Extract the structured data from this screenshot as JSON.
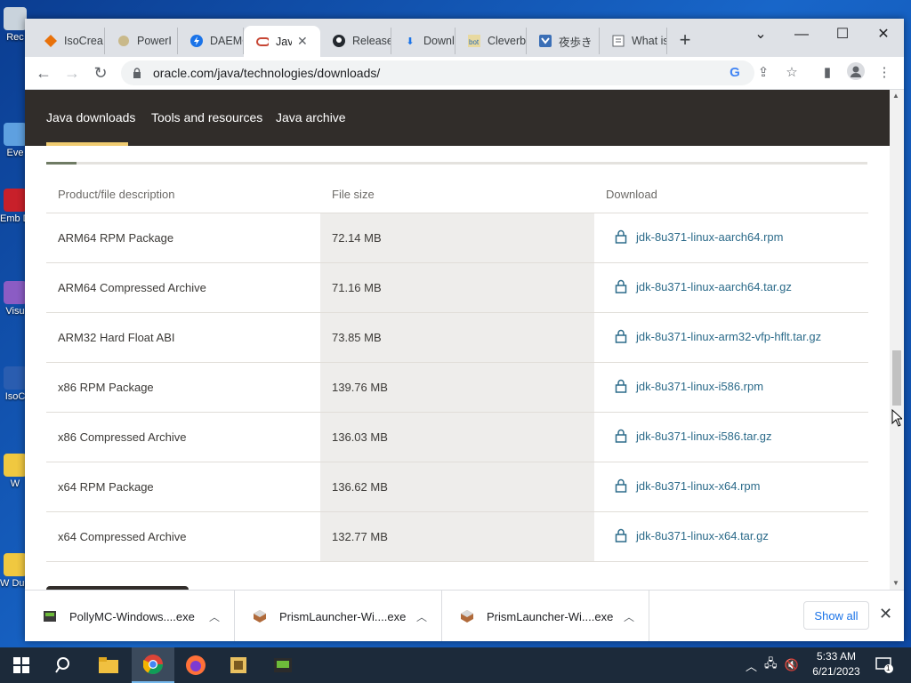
{
  "desktop": {
    "icons": [
      {
        "label": "Rec"
      },
      {
        "label": "Eve"
      },
      {
        "label": "Emb De"
      },
      {
        "label": "Visu"
      },
      {
        "label": "IsoC"
      },
      {
        "label": "W"
      },
      {
        "label": "W Dupl"
      }
    ]
  },
  "browser": {
    "tabs": [
      {
        "label": "IsoCrea",
        "icon": "isocreator-icon"
      },
      {
        "label": "PowerI",
        "icon": "powerlauncher-icon"
      },
      {
        "label": "DAEMC",
        "icon": "daemon-icon"
      },
      {
        "label": "Java",
        "icon": "oracle-icon",
        "active": true
      },
      {
        "label": "Release",
        "icon": "github-icon"
      },
      {
        "label": "Downlo",
        "icon": "download-icon"
      },
      {
        "label": "Cleverb",
        "icon": "cleverbot-icon"
      },
      {
        "label": "夜歩き",
        "icon": "site-icon"
      },
      {
        "label": "What is",
        "icon": "page-icon"
      }
    ],
    "new_tab": "+",
    "address": "oracle.com/java/technologies/downloads/"
  },
  "site_nav": {
    "items": [
      "Java downloads",
      "Tools and resources",
      "Java archive"
    ]
  },
  "downloads_table": {
    "headers": [
      "Product/file description",
      "File size",
      "Download"
    ],
    "rows": [
      {
        "desc": "ARM64 RPM Package",
        "size": "72.14 MB",
        "file": "jdk-8u371-linux-aarch64.rpm"
      },
      {
        "desc": "ARM64 Compressed Archive",
        "size": "71.16 MB",
        "file": "jdk-8u371-linux-aarch64.tar.gz"
      },
      {
        "desc": "ARM32 Hard Float ABI",
        "size": "73.85 MB",
        "file": "jdk-8u371-linux-arm32-vfp-hflt.tar.gz"
      },
      {
        "desc": "x86 RPM Package",
        "size": "139.76 MB",
        "file": "jdk-8u371-linux-i586.rpm"
      },
      {
        "desc": "x86 Compressed Archive",
        "size": "136.03 MB",
        "file": "jdk-8u371-linux-i586.tar.gz"
      },
      {
        "desc": "x64 RPM Package",
        "size": "136.62 MB",
        "file": "jdk-8u371-linux-x64.rpm"
      },
      {
        "desc": "x64 Compressed Archive",
        "size": "132.77 MB",
        "file": "jdk-8u371-linux-x64.tar.gz"
      }
    ]
  },
  "download_bar": {
    "items": [
      {
        "name": "PollyMC-Windows....exe"
      },
      {
        "name": "PrismLauncher-Wi....exe"
      },
      {
        "name": "PrismLauncher-Wi....exe"
      }
    ],
    "show_all": "Show all"
  },
  "taskbar": {
    "time": "5:33 AM",
    "date": "6/21/2023",
    "notification_count": "1"
  },
  "colors": {
    "site_nav_bg": "#312d2a",
    "nav_underline": "#f0cc71",
    "link": "#2c6b8a",
    "taskbar": "#1c2a3a"
  }
}
